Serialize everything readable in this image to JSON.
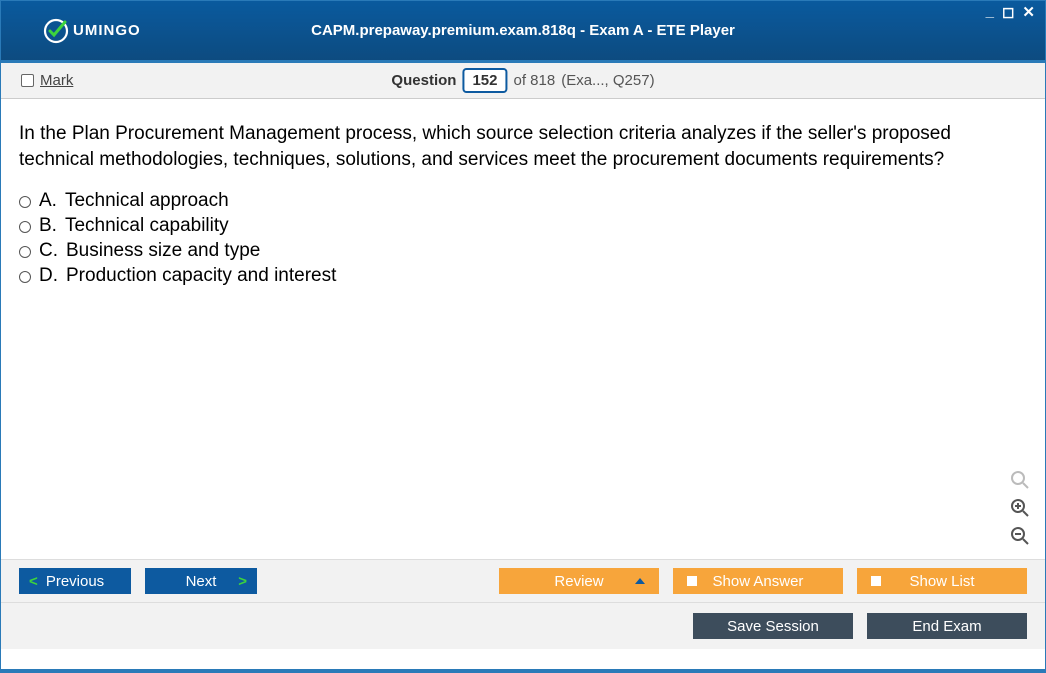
{
  "window": {
    "title": "CAPM.prepaway.premium.exam.818q - Exam A - ETE Player",
    "logo_text": "UMINGO"
  },
  "subbar": {
    "mark_label": "Mark",
    "question_label": "Question",
    "current_number": "152",
    "total_text": "of 818",
    "context": "(Exa..., Q257)"
  },
  "question": {
    "text": "In the Plan Procurement Management process, which source selection criteria analyzes if the seller's proposed technical methodologies, techniques, solutions, and services meet the procurement documents requirements?",
    "options": [
      {
        "letter": "A.",
        "text": "Technical approach"
      },
      {
        "letter": "B.",
        "text": "Technical capability"
      },
      {
        "letter": "C.",
        "text": "Business size and type"
      },
      {
        "letter": "D.",
        "text": "Production capacity and interest"
      }
    ]
  },
  "buttons": {
    "previous": "Previous",
    "next": "Next",
    "review": "Review",
    "show_answer": "Show Answer",
    "show_list": "Show List",
    "save_session": "Save Session",
    "end_exam": "End Exam"
  }
}
